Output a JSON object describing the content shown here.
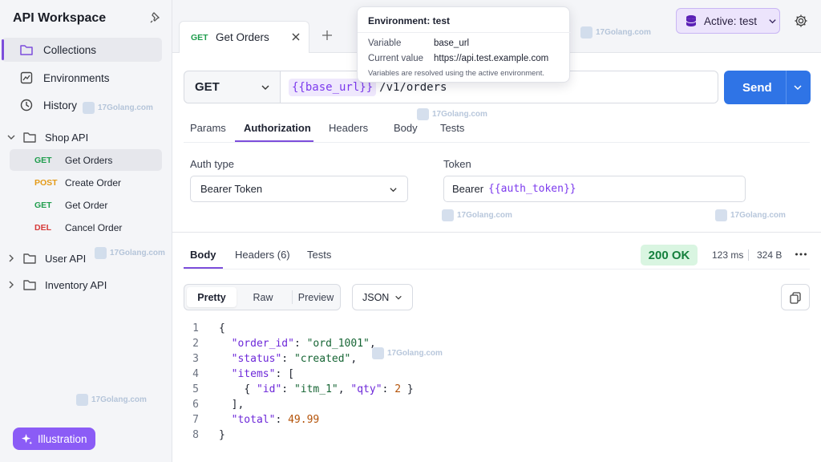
{
  "sidebar": {
    "title": "API Workspace",
    "nav": [
      {
        "label": "Collections"
      },
      {
        "label": "Environments"
      },
      {
        "label": "History"
      }
    ],
    "folders": [
      {
        "name": "Shop API",
        "expanded": true,
        "requests": [
          {
            "method": "GET",
            "name": "Get Orders"
          },
          {
            "method": "POST",
            "name": "Create Order"
          },
          {
            "method": "GET",
            "name": "Get Order"
          },
          {
            "method": "DEL",
            "name": "Cancel Order"
          }
        ]
      },
      {
        "name": "User API",
        "expanded": false
      },
      {
        "name": "Inventory API",
        "expanded": false
      }
    ],
    "illustration_label": "Illustration"
  },
  "tabs": [
    {
      "method": "GET",
      "label": "Get Orders"
    }
  ],
  "environment": {
    "selector_label": "Active: test",
    "popover": {
      "title": "Environment: test",
      "variable_key": "Variable",
      "variable_value": "base_url",
      "current_key": "Current value",
      "current_value": "https://api.test.example.com",
      "note": "Variables are resolved using the active environment."
    }
  },
  "request": {
    "method": "GET",
    "url_var": "{{base_url}}",
    "url_path": "/v1/orders",
    "send_label": "Send",
    "tabs": [
      "Params",
      "Authorization",
      "Headers",
      "Body",
      "Tests"
    ],
    "active_tab": "Authorization",
    "auth": {
      "type_label": "Auth type",
      "type_value": "Bearer Token",
      "token_label": "Token",
      "token_prefix": "Bearer",
      "token_var": "{{auth_token}}"
    }
  },
  "response": {
    "tabs": [
      "Body",
      "Headers (6)",
      "Tests"
    ],
    "active_tab": "Body",
    "status": "200 OK",
    "time": "123 ms",
    "size": "324 B",
    "views": [
      "Pretty",
      "Raw",
      "Preview"
    ],
    "active_view": "Pretty",
    "format": "JSON",
    "line_numbers": [
      "1",
      "2",
      "3",
      "4",
      "5",
      "6",
      "7",
      "8"
    ]
  },
  "watermark": "17Golang.com",
  "colors": {
    "accent": "#7c4ddb",
    "send": "#2f74e6",
    "get": "#1f9d4d",
    "post": "#e49a17",
    "del": "#d63a3a",
    "ok": "#15803d"
  }
}
